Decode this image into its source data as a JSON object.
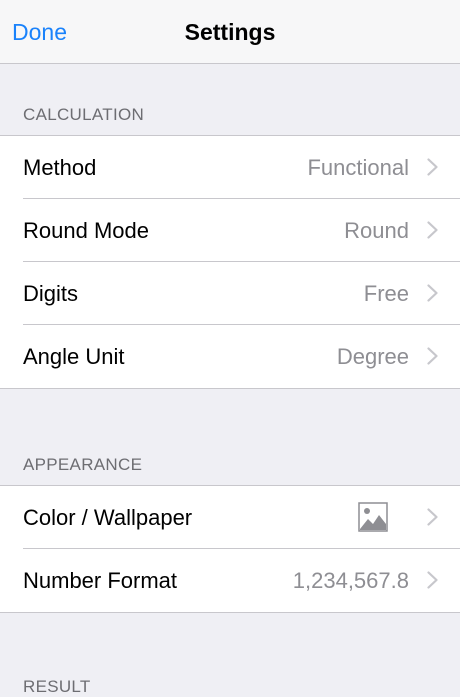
{
  "navbar": {
    "done_label": "Done",
    "title": "Settings"
  },
  "sections": {
    "calculation": {
      "header": "CALCULATION",
      "rows": [
        {
          "label": "Method",
          "value": "Functional"
        },
        {
          "label": "Round Mode",
          "value": "Round"
        },
        {
          "label": "Digits",
          "value": "Free"
        },
        {
          "label": "Angle Unit",
          "value": "Degree"
        }
      ]
    },
    "appearance": {
      "header": "APPEARANCE",
      "rows": [
        {
          "label": "Color / Wallpaper",
          "icon": "image-icon"
        },
        {
          "label": "Number Format",
          "value": "1,234,567.8"
        }
      ]
    },
    "result": {
      "header": "RESULT"
    }
  },
  "colors": {
    "accent": "#1a82fb",
    "background": "#efeff4",
    "secondary_text": "#8e8e93",
    "section_header": "#6d6d72",
    "separator": "#c8c7cc"
  }
}
